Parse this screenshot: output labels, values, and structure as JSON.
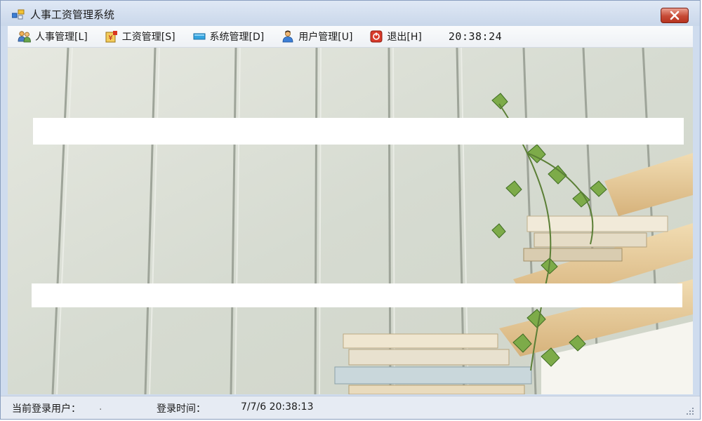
{
  "window": {
    "title": "人事工资管理系统"
  },
  "menu": {
    "items": [
      {
        "label": "人事管理[L]",
        "icon": "people-icon"
      },
      {
        "label": "工资管理[S]",
        "icon": "salary-icon"
      },
      {
        "label": "系统管理[D]",
        "icon": "system-icon"
      },
      {
        "label": "用户管理[U]",
        "icon": "user-icon"
      },
      {
        "label": "退出[H]",
        "icon": "exit-icon"
      }
    ],
    "clock": "20:38:24"
  },
  "status": {
    "user_label": "当前登录用户：",
    "user_value": ".",
    "time_label": "登录时间：",
    "time_value": "7/7/6 20:38:13"
  },
  "colors": {
    "titlebar": "#cfdcee",
    "close_button": "#c64a35",
    "statusbar": "#e6ebf3"
  }
}
